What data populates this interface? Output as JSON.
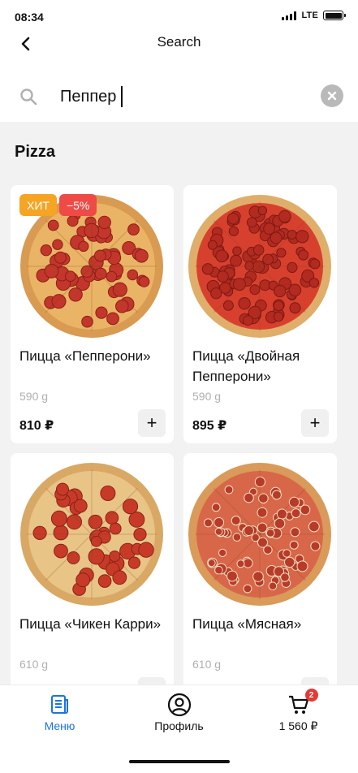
{
  "status_bar": {
    "time": "08:34",
    "network": "LTE"
  },
  "header": {
    "title": "Search"
  },
  "search": {
    "value": "Пеппер",
    "placeholder": ""
  },
  "section": {
    "title": "Pizza"
  },
  "products": [
    {
      "name": "Пицца «Пепперони»",
      "weight": "590 g",
      "price": "810 ₽",
      "badges": [
        "ХИТ",
        "−5%"
      ],
      "style": "pepperoni"
    },
    {
      "name": "Пицца «Двойная Пепперони»",
      "weight": "590 g",
      "price": "895 ₽",
      "badges": [],
      "style": "double"
    },
    {
      "name": "Пицца «Чикен Карри»",
      "weight": "610 g",
      "price": "",
      "badges": [],
      "style": "chicken"
    },
    {
      "name": "Пицца «Мясная»",
      "weight": "610 g",
      "price": "",
      "badges": [],
      "style": "meat"
    }
  ],
  "add_label": "+",
  "tabs": [
    {
      "label": "Меню",
      "icon": "menu-icon",
      "active": true
    },
    {
      "label": "Профиль",
      "icon": "profile-icon",
      "active": false
    },
    {
      "label": "1 560 ₽",
      "icon": "cart-icon",
      "active": false,
      "badge": "2"
    }
  ],
  "colors": {
    "accent": "#1a73e8",
    "hit_badge": "#f5a423",
    "discount_badge": "#ef4a45",
    "cart_badge": "#e53935"
  }
}
